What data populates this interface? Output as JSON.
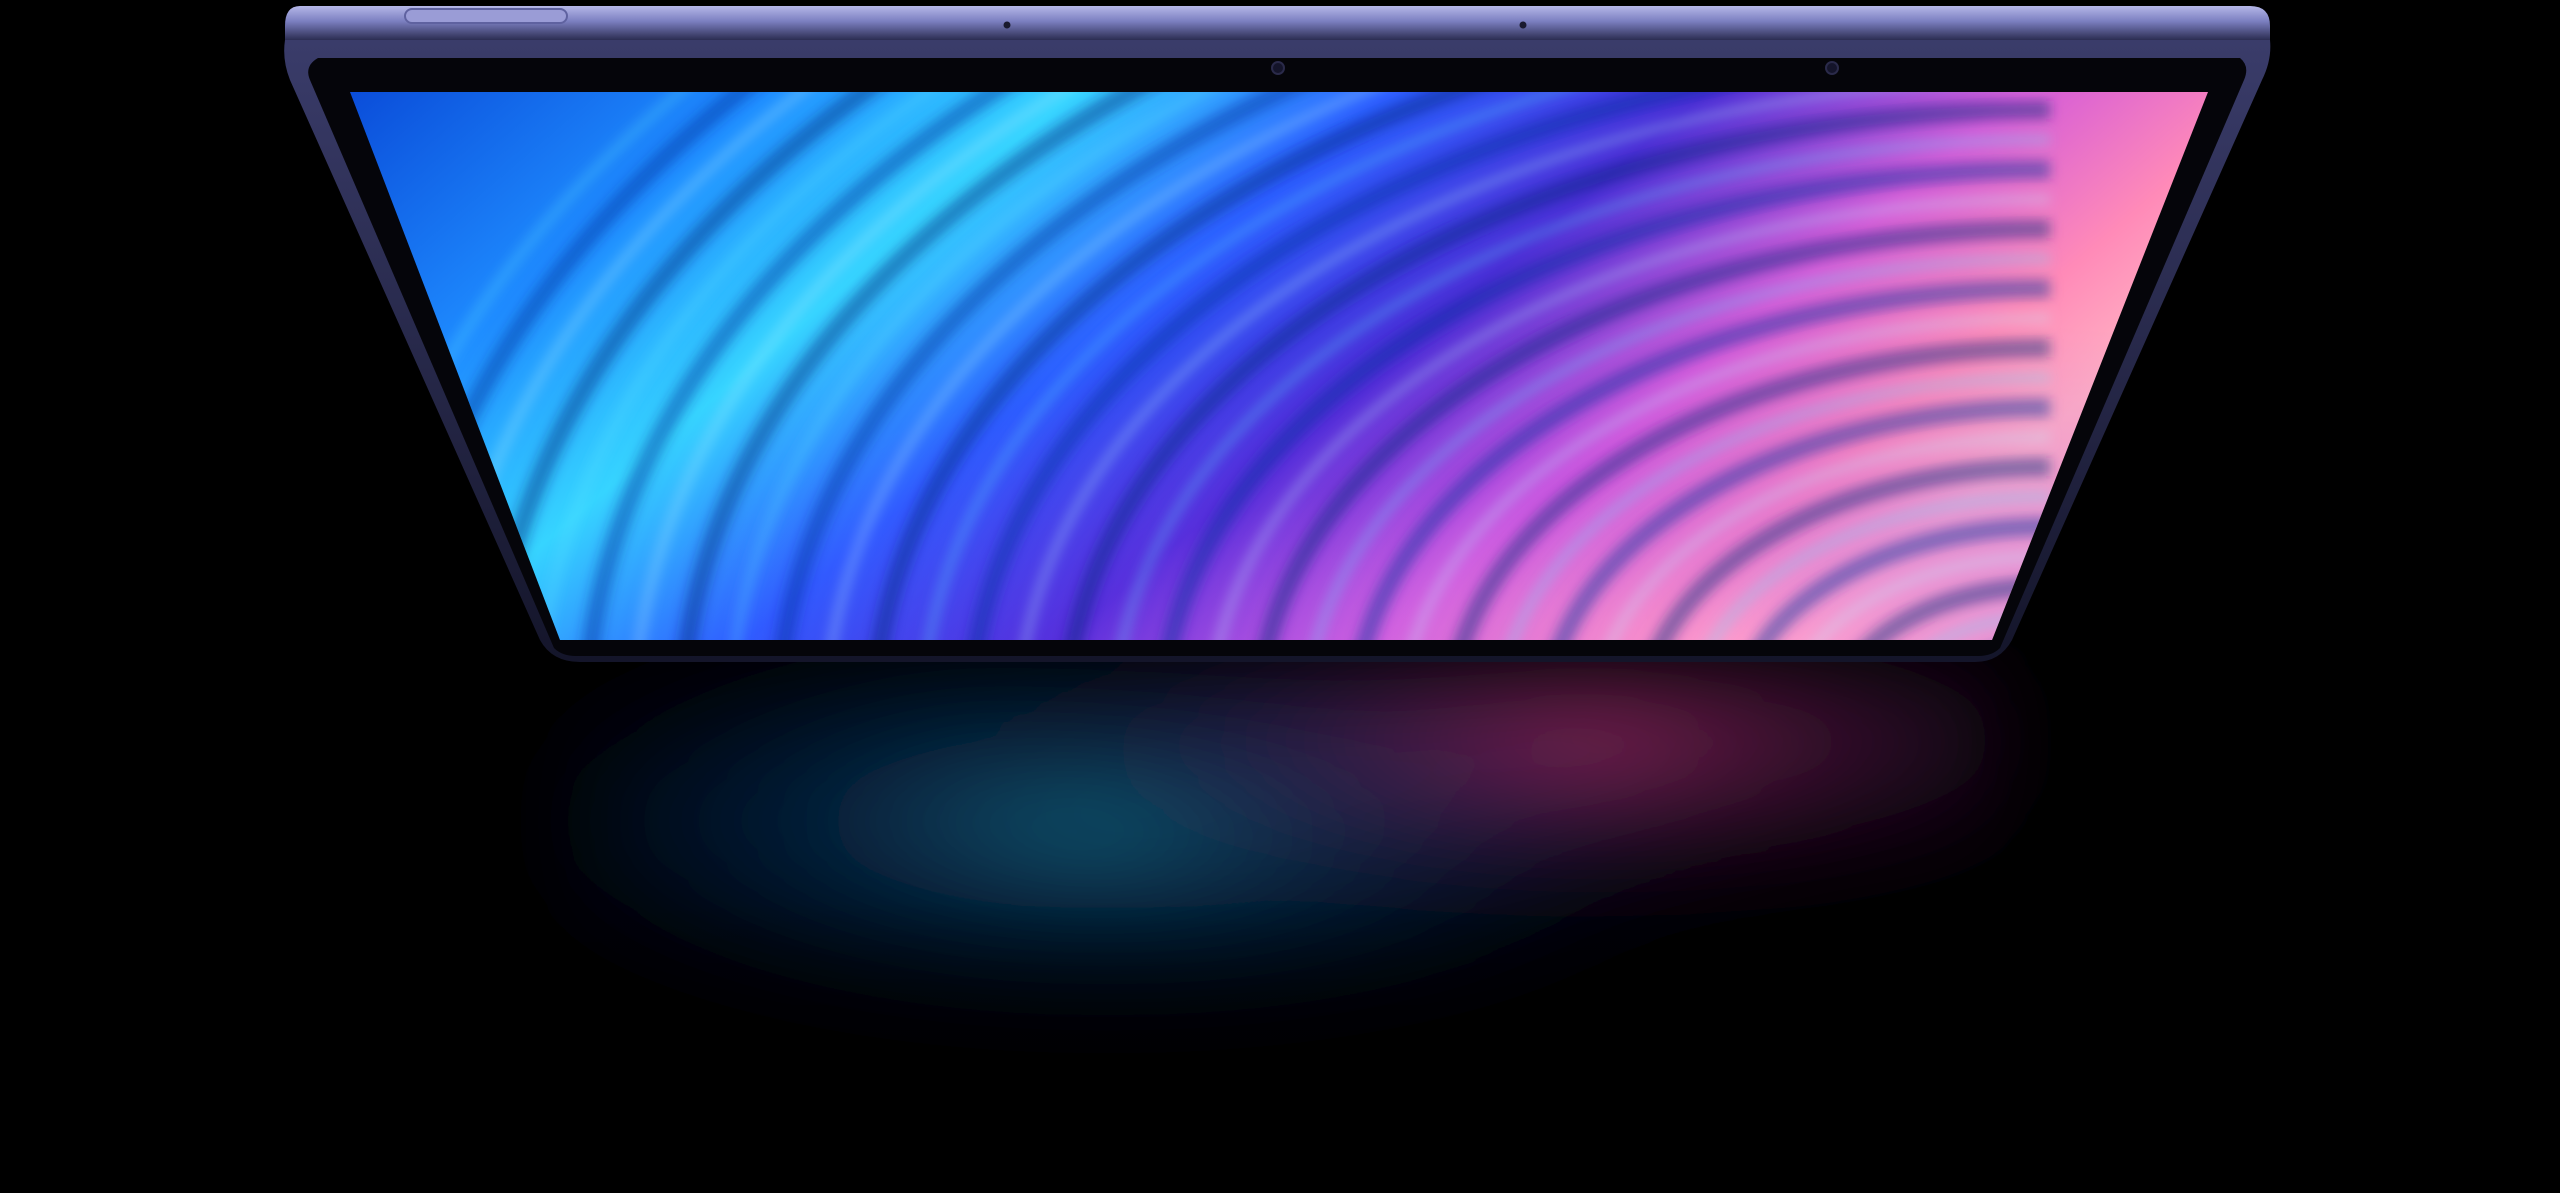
{
  "scene": {
    "subject": "tablet-device",
    "colors": {
      "background": "#000000",
      "frame_top": "#8a8cc8",
      "frame_edge": "#2a2b4a",
      "bezel": "#06060c",
      "screen_blue": "#1e6bff",
      "screen_cyan": "#35d2ff",
      "screen_purple": "#6a3cff",
      "screen_pink": "#ff6fd6",
      "screen_orange": "#ff9aa6",
      "reflection_teal": "#0e6b86",
      "reflection_pink": "#a0286a"
    }
  }
}
